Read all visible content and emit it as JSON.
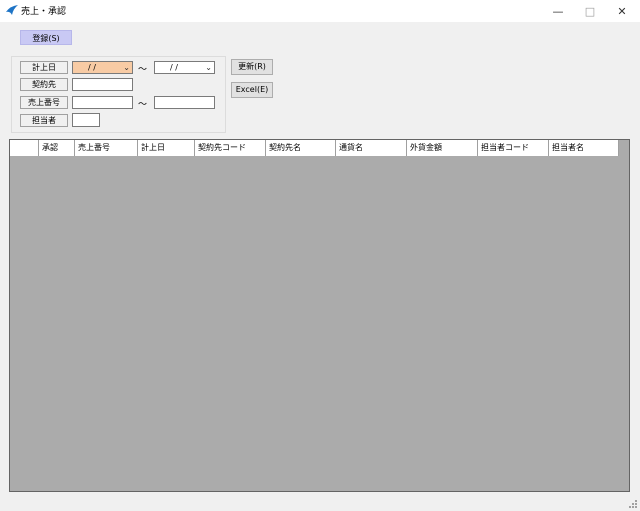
{
  "window": {
    "title": "売上・承認",
    "minimize": "—",
    "maximize": "□",
    "close": "✕"
  },
  "toolbar": {
    "register_label": "登録(S)"
  },
  "filters": {
    "date_label": "計上日",
    "date_from": "/  /",
    "date_to": "/  /",
    "date_tilde": "～",
    "contractor_label": "契約先",
    "contractor_value": "",
    "sales_no_label": "売上番号",
    "sales_no_from": "",
    "sales_no_to": "",
    "sales_no_tilde": "～",
    "person_label": "担当者",
    "person_value": ""
  },
  "actions": {
    "refresh_label": "更新(R)",
    "excel_label": "Excel(E)"
  },
  "grid": {
    "columns": [
      "",
      "承認",
      "売上番号",
      "計上日",
      "契約先コード",
      "契約先名",
      "通貨名",
      "外貨金額",
      "担当者コード",
      "担当者名"
    ],
    "rows": []
  },
  "colors": {
    "date_highlight": "#f8cba4",
    "register_button": "#c9c9f4",
    "grid_background": "#ababab"
  }
}
